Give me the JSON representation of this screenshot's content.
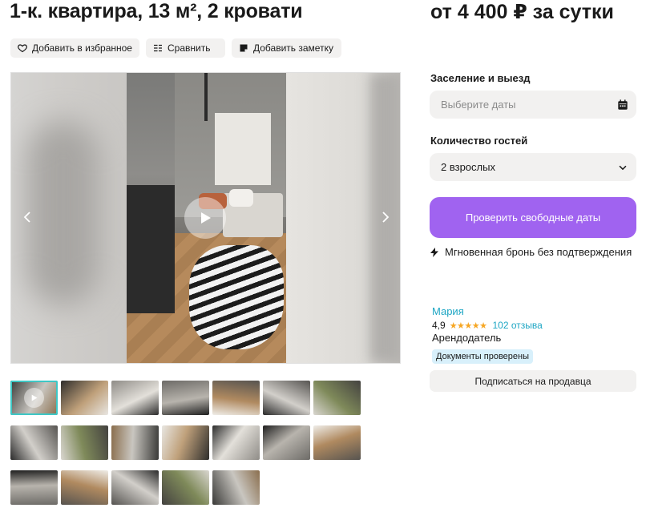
{
  "listing": {
    "title": "1-к. квартира, 13 м², 2 кровати",
    "price": "от 4 400 ₽ за сутки"
  },
  "actions": {
    "favorite_label": "Добавить в избранное",
    "compare_label": "Сравнить",
    "note_label": "Добавить заметку"
  },
  "gallery": {
    "prev_icon": "chevron-left-icon",
    "next_icon": "chevron-right-icon",
    "play_icon": "play-icon",
    "thumbnail_count": 19
  },
  "booking": {
    "dates_label": "Заселение и выезд",
    "dates_placeholder": "Выберите даты",
    "guests_label": "Количество гостей",
    "guests_value": "2 взрослых",
    "check_button": "Проверить свободные даты",
    "instant_text": "Мгновенная бронь без подтверждения"
  },
  "seller": {
    "name": "Мария",
    "rating": "4,9",
    "stars": "★★★★★",
    "reviews": "102 отзыва",
    "role": "Арендодатель",
    "badge": "Документы проверены",
    "subscribe_label": "Подписаться на продавца"
  },
  "colors": {
    "accent": "#a063f0",
    "link": "#1ea6c4",
    "star": "#f6a623",
    "badge_bg": "#d8f0fb",
    "thumb_active": "#3ec7c5"
  }
}
